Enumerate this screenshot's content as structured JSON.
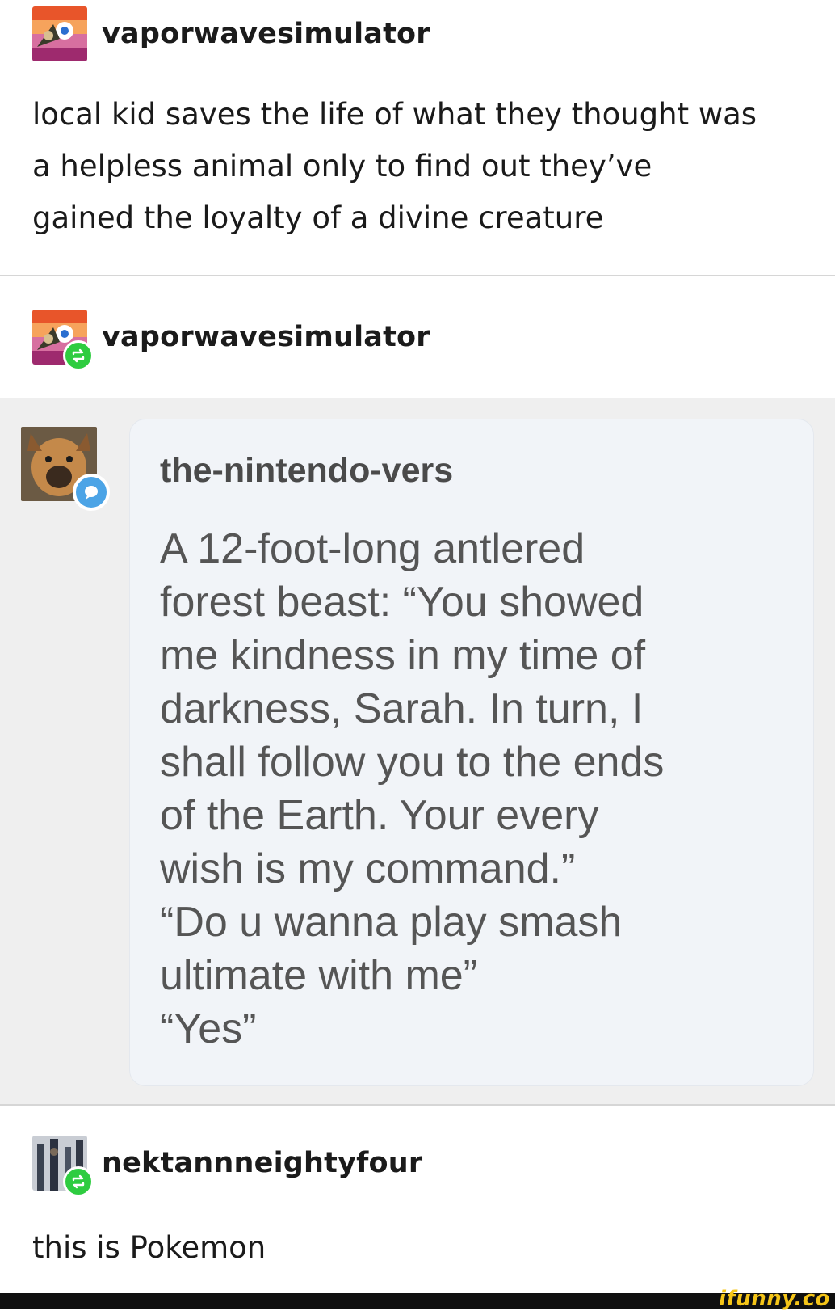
{
  "posts": [
    {
      "username": "vaporwavesimulator",
      "body": "local kid saves the life of what they thought was\na helpless animal only to find out they’ve\ngained the loyalty of a divine creature"
    },
    {
      "username": "vaporwavesimulator"
    },
    {
      "username": "nektannneightyfour",
      "body": "this is Pokemon"
    }
  ],
  "quoted": {
    "username": "the-nintendo-vers",
    "text": "A 12-foot-long antlered\nforest beast: “You showed\nme kindness in my time of\ndarkness, Sarah. In turn, I\nshall follow you to the ends\nof the Earth. Your every\nwish is my command.”\n“Do u wanna play smash\nultimate with me”\n“Yes”"
  },
  "icons": {
    "reblog": "reblog-icon",
    "chat": "chat-bubble-icon"
  },
  "colors": {
    "reblog_green": "#2ecc40",
    "chat_blue": "#4ca4e6",
    "watermark_yellow": "#f5c518"
  },
  "watermark": "ifunny.co"
}
